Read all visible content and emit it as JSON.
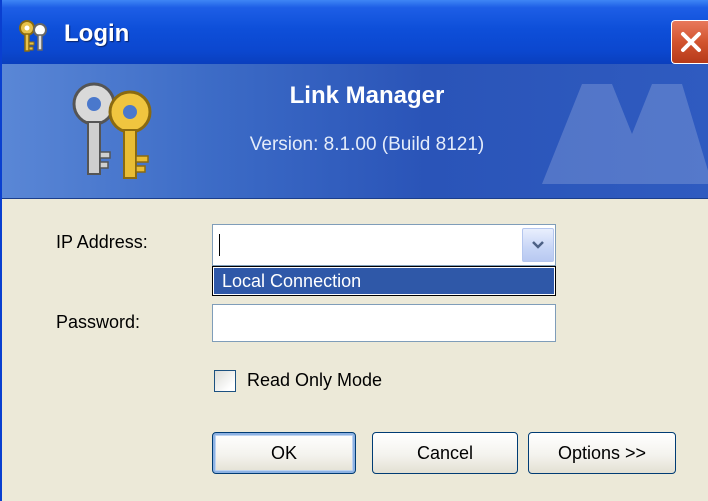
{
  "window": {
    "title": "Login"
  },
  "banner": {
    "app_name": "Link Manager",
    "version": "Version: 8.1.00 (Build 8121)"
  },
  "form": {
    "ip_label": "IP Address:",
    "ip_value": "",
    "ip_options": [
      "Local Connection"
    ],
    "password_label": "Password:",
    "password_value": "",
    "read_only_label": "Read Only Mode",
    "read_only_checked": false
  },
  "buttons": {
    "ok": "OK",
    "cancel": "Cancel",
    "options": "Options >>"
  },
  "icons": {
    "title": "keys-icon",
    "close": "close-icon",
    "dropdown": "chevron-down-icon",
    "banner": "keys-icon"
  },
  "colors": {
    "titlebar": "#0B47CF",
    "close": "#D2542F",
    "selection": "#2F58A8",
    "dialog": "#ECE9D8"
  }
}
